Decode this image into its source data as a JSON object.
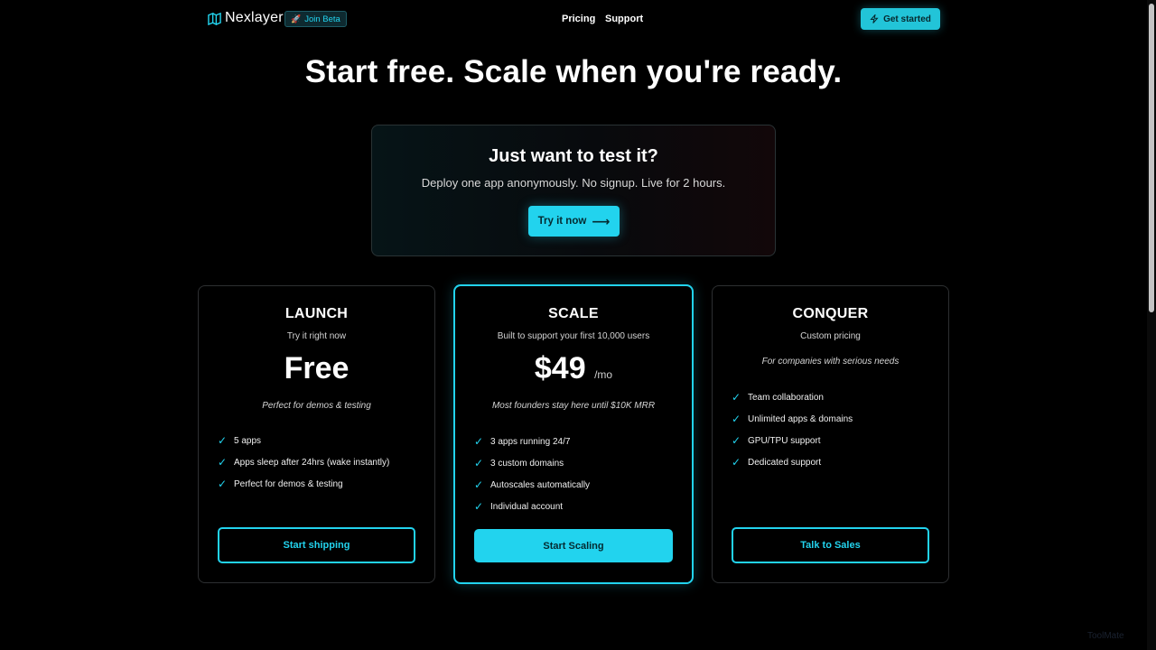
{
  "nav": {
    "brand": "Nexlayer",
    "beta_label": "Join Beta",
    "links": [
      "Pricing",
      "Support"
    ],
    "cta_label": "Get started"
  },
  "hero": {
    "title": "Start free. Scale when you're ready."
  },
  "test_box": {
    "title": "Just want to test it?",
    "subtitle": "Deploy one app anonymously. No signup. Live for 2 hours.",
    "button_label": "Try it now",
    "button_arrow": "⟶"
  },
  "plans": [
    {
      "name": "LAUNCH",
      "tagline": "Try it right now",
      "price": "Free",
      "price_unit": "",
      "note": "Perfect for demos & testing",
      "features": [
        "5 apps",
        "Apps sleep after 24hrs (wake instantly)",
        "Perfect for demos & testing"
      ],
      "button_label": "Start shipping"
    },
    {
      "name": "SCALE",
      "tagline": "Built to support your first 10,000 users",
      "price": "$49",
      "price_unit": "/mo",
      "note": "Most founders stay here until $10K MRR",
      "features": [
        "3 apps running 24/7",
        "3 custom domains",
        "Autoscales automatically",
        "Individual account"
      ],
      "button_label": "Start Scaling"
    },
    {
      "name": "CONQUER",
      "tagline": "Custom pricing",
      "price": "",
      "price_unit": "",
      "note": "For companies with serious needs",
      "features": [
        "Team collaboration",
        "Unlimited apps & domains",
        "GPU/TPU support",
        "Dedicated support"
      ],
      "button_label": "Talk to Sales"
    }
  ],
  "check_glyph": "✓",
  "watermark": "ToolMate",
  "colors": {
    "accent": "#22d3ee",
    "background": "#000000",
    "card_border": "#2d2f31"
  }
}
